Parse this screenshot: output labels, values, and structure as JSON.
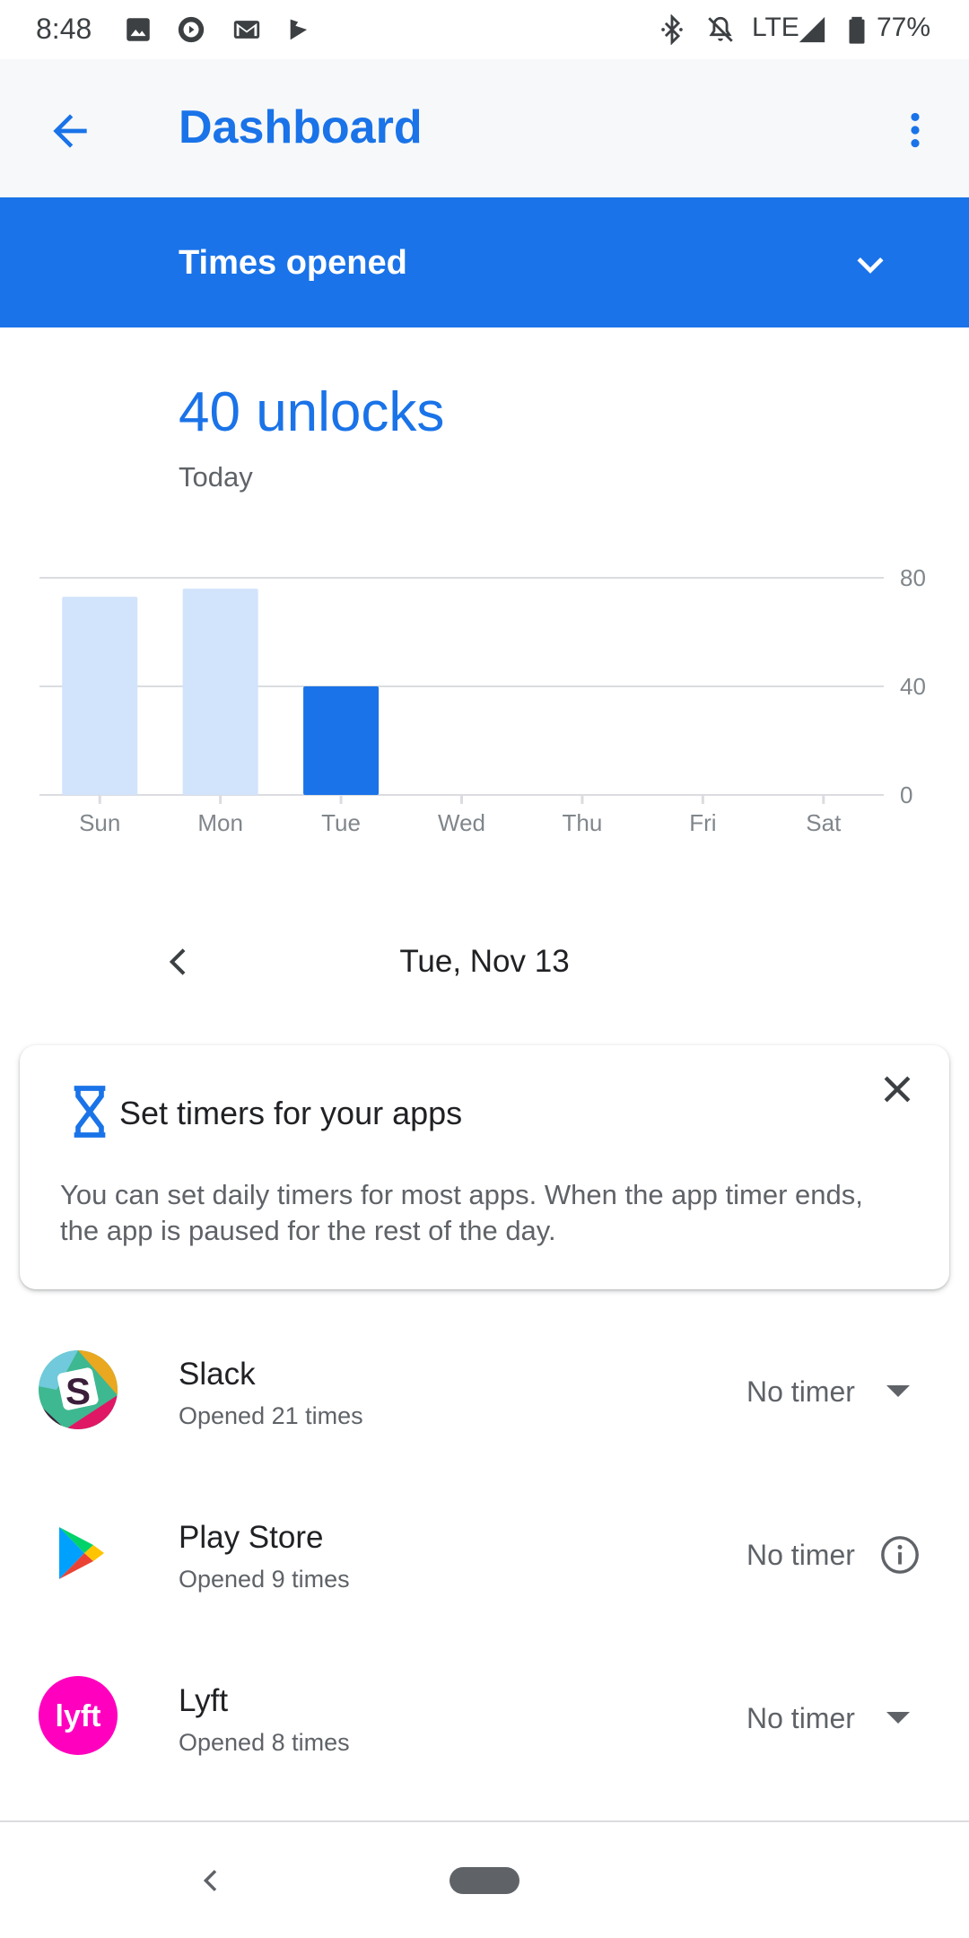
{
  "status_bar": {
    "time": "8:48",
    "network": "LTE",
    "battery": "77%",
    "icons": [
      "photos-icon",
      "play-music-icon",
      "gmail-icon",
      "play-movies-icon",
      "bluetooth-icon",
      "notifications-off-icon",
      "signal-icon",
      "battery-icon"
    ]
  },
  "app_bar": {
    "title": "Dashboard",
    "icons": [
      "back-arrow-icon",
      "more-vert-icon"
    ]
  },
  "filter": {
    "selected": "Times opened",
    "icon": "chevron-down-icon"
  },
  "summary": {
    "value": "40 unlocks",
    "period": "Today"
  },
  "chart_data": {
    "type": "bar",
    "categories": [
      "Sun",
      "Mon",
      "Tue",
      "Wed",
      "Thu",
      "Fri",
      "Sat"
    ],
    "values": [
      73,
      76,
      40,
      null,
      null,
      null,
      null
    ],
    "selected_index": 2,
    "y_ticks": [
      "80",
      "40",
      "0"
    ],
    "ylim": [
      0,
      80
    ],
    "grid": true,
    "colors": {
      "selected": "#1a73e8",
      "other": "#d2e3fc",
      "grid": "#dadce0"
    }
  },
  "date_nav": {
    "label": "Tue, Nov 13",
    "prev_icon": "chevron-left-icon"
  },
  "timer_card": {
    "title": "Set timers for your apps",
    "body": "You can set daily timers for most apps. When the app timer ends, the app is paused for the rest of the day.",
    "icons": [
      "hourglass-icon",
      "close-icon"
    ]
  },
  "apps": [
    {
      "name": "Slack",
      "subtitle": "Opened 21 times",
      "timer": "No timer",
      "action_icon": "dropdown-arrow-icon"
    },
    {
      "name": "Play Store",
      "subtitle": "Opened 9 times",
      "timer": "No timer",
      "action_icon": "info-icon"
    },
    {
      "name": "Lyft",
      "subtitle": "Opened 8 times",
      "timer": "No timer",
      "action_icon": "dropdown-arrow-icon"
    }
  ],
  "colors": {
    "accent": "#1a73e8",
    "lyft": "#ff00bf"
  }
}
